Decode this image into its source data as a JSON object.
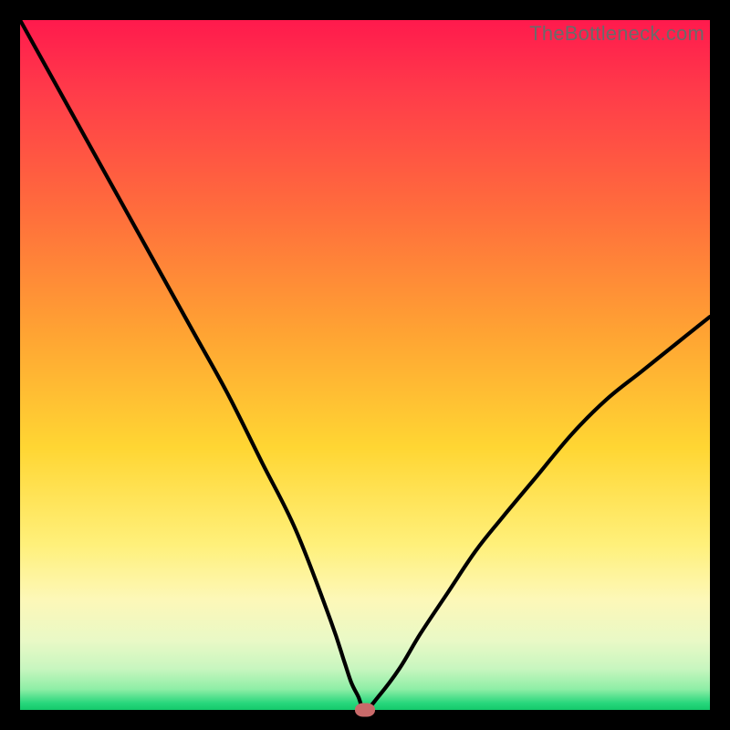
{
  "watermark": "TheBottleneck.com",
  "colors": {
    "frame": "#000000",
    "curve_stroke": "#000000",
    "marker_fill": "#c96a6a",
    "gradient_top": "#ff1a4d",
    "gradient_bottom": "#14c96b"
  },
  "chart_data": {
    "type": "line",
    "title": "",
    "xlabel": "",
    "ylabel": "",
    "xlim": [
      0,
      100
    ],
    "ylim": [
      0,
      100
    ],
    "grid": false,
    "legend": false,
    "annotations": [],
    "series": [
      {
        "name": "bottleneck-curve",
        "x": [
          0,
          5,
          10,
          15,
          20,
          25,
          30,
          35,
          40,
          45,
          47,
          48,
          49,
          50,
          52,
          55,
          58,
          62,
          66,
          70,
          75,
          80,
          85,
          90,
          95,
          100
        ],
        "y": [
          100,
          91,
          82,
          73,
          64,
          55,
          46,
          36,
          26,
          13,
          7,
          4,
          2,
          0,
          2,
          6,
          11,
          17,
          23,
          28,
          34,
          40,
          45,
          49,
          53,
          57
        ]
      }
    ],
    "marker": {
      "x": 50,
      "y": 0
    }
  }
}
